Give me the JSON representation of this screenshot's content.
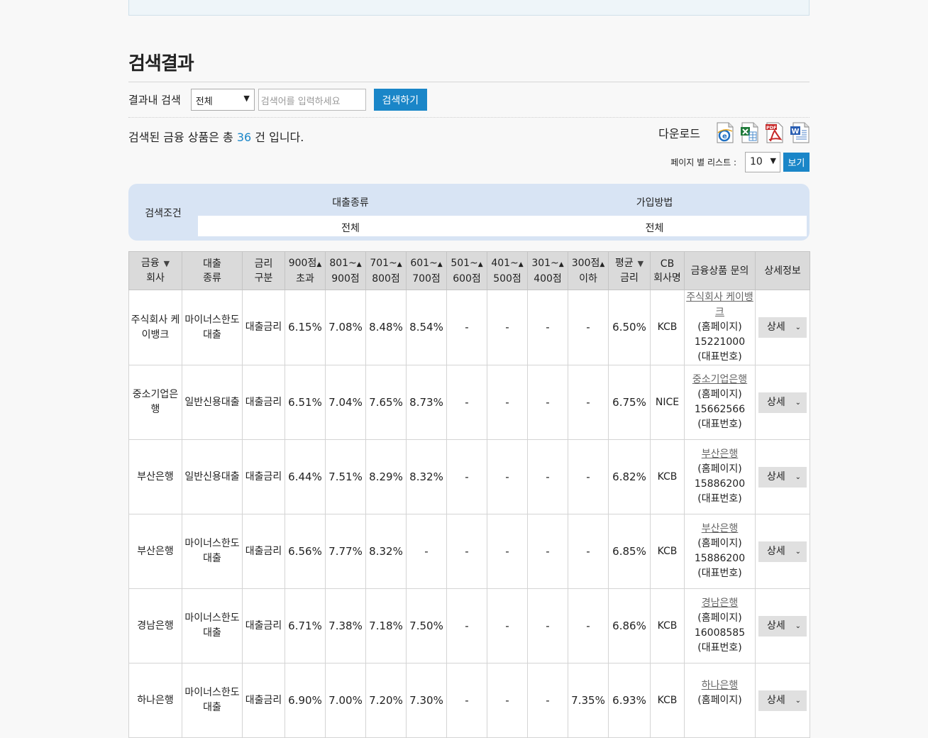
{
  "section_title": "검색결과",
  "search": {
    "label": "결과내 검색",
    "select_value": "전체",
    "placeholder": "검색어를 입력하세요",
    "button": "검색하기"
  },
  "summary": {
    "prefix": "검색된 금융 상품은 총",
    "count": "36",
    "suffix": "건 입니다."
  },
  "download": {
    "label": "다운로드",
    "icons": [
      "ie-icon",
      "excel-icon",
      "pdf-icon",
      "word-icon"
    ]
  },
  "page_size": {
    "label": "페이지 별 리스트 :",
    "value": "10",
    "button": "보기"
  },
  "conditions": {
    "label": "검색조건",
    "col1_header": "대출종류",
    "col2_header": "가입방법",
    "col1_value": "전체",
    "col2_value": "전체"
  },
  "table": {
    "headers": {
      "bank": [
        "금융",
        "회사"
      ],
      "type": [
        "대출",
        "종류"
      ],
      "rate_type": [
        "금리",
        "구분"
      ],
      "s900": [
        "900점",
        "초과"
      ],
      "s801": [
        "801~",
        "900점"
      ],
      "s701": [
        "701~",
        "800점"
      ],
      "s601": [
        "601~",
        "700점"
      ],
      "s501": [
        "501~",
        "600점"
      ],
      "s401": [
        "401~",
        "500점"
      ],
      "s301": [
        "301~",
        "400점"
      ],
      "s300": [
        "300점",
        "이하"
      ],
      "avg": [
        "평균",
        "금리"
      ],
      "cb": [
        "CB",
        "회사명"
      ],
      "inquiry": "금융상품 문의",
      "detail": "상세정보"
    },
    "rows": [
      {
        "bank": "주식회사 케이뱅크",
        "type": "마이너스한도대출",
        "rate_type": "대출금리",
        "s900": "6.15%",
        "s801": "7.08%",
        "s701": "8.48%",
        "s601": "8.54%",
        "s501": "-",
        "s401": "-",
        "s301": "-",
        "s300": "-",
        "avg": "6.50%",
        "cb": "KCB",
        "inq_name": "주식회사 케이뱅크",
        "inq_home": "(홈페이지)",
        "inq_phone": "15221000",
        "inq_rep": "(대표번호)",
        "detail": "상세"
      },
      {
        "bank": "중소기업은행",
        "type": "일반신용대출",
        "rate_type": "대출금리",
        "s900": "6.51%",
        "s801": "7.04%",
        "s701": "7.65%",
        "s601": "8.73%",
        "s501": "-",
        "s401": "-",
        "s301": "-",
        "s300": "-",
        "avg": "6.75%",
        "cb": "NICE",
        "inq_name": "중소기업은행",
        "inq_home": "(홈페이지)",
        "inq_phone": "15662566",
        "inq_rep": "(대표번호)",
        "detail": "상세"
      },
      {
        "bank": "부산은행",
        "type": "일반신용대출",
        "rate_type": "대출금리",
        "s900": "6.44%",
        "s801": "7.51%",
        "s701": "8.29%",
        "s601": "8.32%",
        "s501": "-",
        "s401": "-",
        "s301": "-",
        "s300": "-",
        "avg": "6.82%",
        "cb": "KCB",
        "inq_name": "부산은행",
        "inq_home": "(홈페이지)",
        "inq_phone": "15886200",
        "inq_rep": "(대표번호)",
        "detail": "상세"
      },
      {
        "bank": "부산은행",
        "type": "마이너스한도대출",
        "rate_type": "대출금리",
        "s900": "6.56%",
        "s801": "7.77%",
        "s701": "8.32%",
        "s601": "-",
        "s501": "-",
        "s401": "-",
        "s301": "-",
        "s300": "-",
        "avg": "6.85%",
        "cb": "KCB",
        "inq_name": "부산은행",
        "inq_home": "(홈페이지)",
        "inq_phone": "15886200",
        "inq_rep": "(대표번호)",
        "detail": "상세"
      },
      {
        "bank": "경남은행",
        "type": "마이너스한도대출",
        "rate_type": "대출금리",
        "s900": "6.71%",
        "s801": "7.38%",
        "s701": "7.18%",
        "s601": "7.50%",
        "s501": "-",
        "s401": "-",
        "s301": "-",
        "s300": "-",
        "avg": "6.86%",
        "cb": "KCB",
        "inq_name": "경남은행",
        "inq_home": "(홈페이지)",
        "inq_phone": "16008585",
        "inq_rep": "(대표번호)",
        "detail": "상세"
      },
      {
        "bank": "하나은행",
        "type": "마이너스한도대출",
        "rate_type": "대출금리",
        "s900": "6.90%",
        "s801": "7.00%",
        "s701": "7.20%",
        "s601": "7.30%",
        "s501": "-",
        "s401": "-",
        "s301": "-",
        "s300": "7.35%",
        "avg": "6.93%",
        "cb": "KCB",
        "inq_name": "하나은행",
        "inq_home": "(홈페이지)",
        "inq_phone": "",
        "inq_rep": "",
        "detail": "상세"
      }
    ]
  }
}
